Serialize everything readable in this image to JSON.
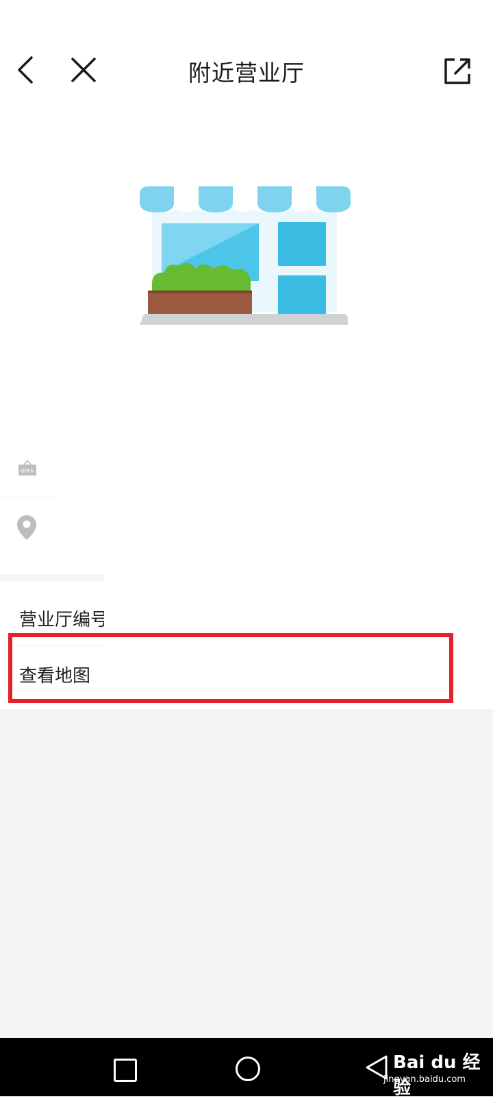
{
  "header": {
    "title": "附近营业厅",
    "back_icon": "chevron-left-icon",
    "close_icon": "close-icon",
    "share_icon": "share-external-icon"
  },
  "illustration": {
    "name": "storefront-illustration",
    "colors": {
      "awning": "#7fd3ee",
      "awning_stripe": "#ffffff",
      "window": "#4cc5e8",
      "planter": "#9b5a40",
      "plant": "#66bb33",
      "ground": "#d0d0d0"
    }
  },
  "info_rows": [
    {
      "icon": "open-sign-icon",
      "icon_text": "OPEN"
    },
    {
      "icon": "location-pin-icon"
    }
  ],
  "list_items": [
    {
      "label": "营业厅编号"
    },
    {
      "label": "查看地图"
    }
  ],
  "highlight_color": "#e3212b",
  "system_nav": {
    "recent_icon": "square-icon",
    "home_icon": "circle-icon",
    "back_icon": "triangle-back-icon"
  },
  "watermark": {
    "brand": "Bai du 经验",
    "url": "jingyan.baidu.com"
  }
}
